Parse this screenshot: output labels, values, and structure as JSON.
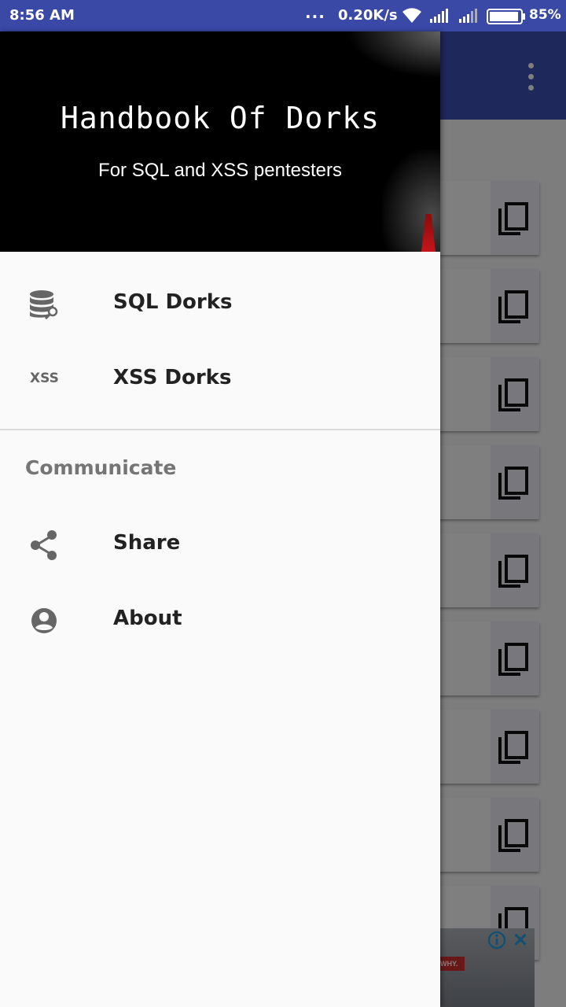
{
  "status_bar": {
    "time": "8:56 AM",
    "dots": "...",
    "speed": "0.20K/s",
    "battery": "85%",
    "icons": [
      "wifi-icon",
      "signal-icon",
      "signal-icon",
      "battery-icon"
    ]
  },
  "drawer": {
    "header": {
      "title": "Handbook Of Dorks",
      "subtitle": "For SQL and XSS pentesters"
    },
    "items": [
      {
        "label": "SQL Dorks",
        "icon": "database-icon"
      },
      {
        "label": "XSS Dorks",
        "icon_text": "XSS"
      }
    ],
    "section_title": "Communicate",
    "section_items": [
      {
        "label": "Share",
        "icon": "share-icon"
      },
      {
        "label": "About",
        "icon": "account-circle-icon"
      }
    ]
  },
  "background_app": {
    "copy_cards": 9,
    "ad_text": "WHY."
  },
  "colors": {
    "app_bar": "#3f51b5",
    "status_bar": "#3a48a6",
    "drawer_bg": "#fafafa",
    "ad_close": "#2aa0e0"
  }
}
